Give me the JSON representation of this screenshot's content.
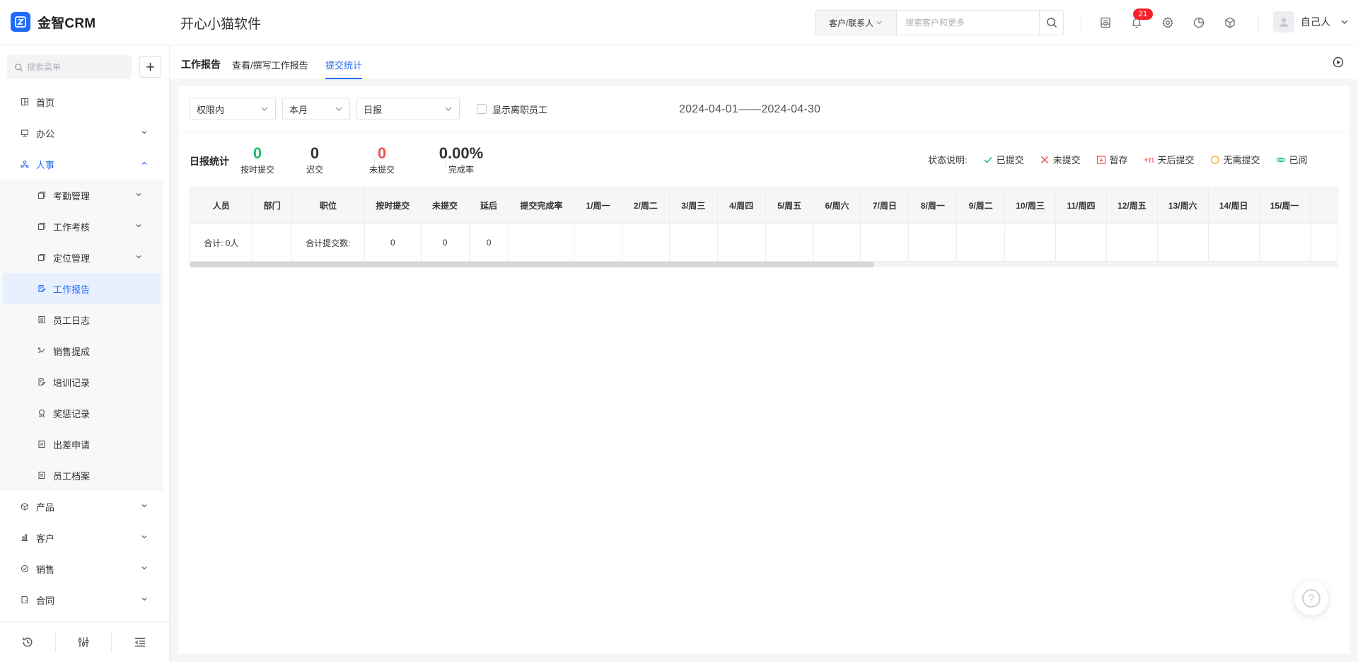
{
  "header": {
    "logo_text": "金智CRM",
    "company_name": "开心小猫软件",
    "search_type": "客户/联系人",
    "search_placeholder": "搜索客户和更多",
    "notification_count": "21",
    "user_name": "自己人",
    "accent_color": "#1f6bff"
  },
  "sidebar": {
    "search_placeholder": "搜索菜单",
    "add_label": "+",
    "items": [
      {
        "label": "首页",
        "icon": "home-icon"
      },
      {
        "label": "办公",
        "icon": "office-icon"
      },
      {
        "label": "人事",
        "icon": "hr-icon"
      },
      {
        "label": "产品",
        "icon": "product-icon"
      },
      {
        "label": "客户",
        "icon": "customer-icon"
      },
      {
        "label": "销售",
        "icon": "sales-icon"
      },
      {
        "label": "合同",
        "icon": "contract-icon"
      }
    ],
    "hr_children": [
      {
        "label": "考勤管理",
        "icon": "attendance-icon"
      },
      {
        "label": "工作考核",
        "icon": "assessment-icon"
      },
      {
        "label": "定位管理",
        "icon": "location-icon"
      },
      {
        "label": "工作报告",
        "icon": "report-icon"
      },
      {
        "label": "员工日志",
        "icon": "log-icon"
      },
      {
        "label": "销售提成",
        "icon": "commission-icon"
      },
      {
        "label": "培训记录",
        "icon": "training-icon"
      },
      {
        "label": "奖惩记录",
        "icon": "reward-icon"
      },
      {
        "label": "出差申请",
        "icon": "trip-icon"
      },
      {
        "label": "员工档案",
        "icon": "archive-icon"
      }
    ]
  },
  "tabs": {
    "title": "工作报告",
    "items": [
      "查看/撰写工作报告",
      "提交统计"
    ],
    "active": "提交统计"
  },
  "filters": {
    "scope": "权限内",
    "period": "本月",
    "report_type": "日报",
    "show_resigned_label": "显示离职员工",
    "date_range": "2024-04-01——2024-04-30"
  },
  "stats": {
    "title": "日报统计",
    "on_time": {
      "value": "0",
      "label": "按时提交",
      "color": "#19be6b"
    },
    "late": {
      "value": "0",
      "label": "迟交",
      "color": "#333333"
    },
    "not_submitted": {
      "value": "0",
      "label": "未提交",
      "color": "#f0504f"
    },
    "completion": {
      "value": "0.00%",
      "label": "完成率",
      "color": "#333333"
    }
  },
  "legend": {
    "title": "状态说明:",
    "items": [
      {
        "symbol": "",
        "label": "已提交",
        "color": "#19be6b",
        "icon": "check-icon"
      },
      {
        "symbol": "",
        "label": "未提交",
        "color": "#f0504f",
        "icon": "cross-icon"
      },
      {
        "symbol": "",
        "label": "暂存",
        "color": "#f0504f",
        "icon": "draft-icon"
      },
      {
        "symbol": "+n",
        "label": "天后提交",
        "color": "#f0504f",
        "icon": ""
      },
      {
        "symbol": "",
        "label": "无需提交",
        "color": "#f5a623",
        "icon": "circle-icon"
      },
      {
        "symbol": "",
        "label": "已阅",
        "color": "#19be6b",
        "icon": "eye-icon"
      }
    ]
  },
  "table": {
    "columns": [
      "人员",
      "部门",
      "职位",
      "按时提交",
      "未提交",
      "延后",
      "提交完成率",
      "1/周一",
      "2/周二",
      "3/周三",
      "4/周四",
      "5/周五",
      "6/周六",
      "7/周日",
      "8/周一",
      "9/周二",
      "10/周三",
      "11/周四",
      "12/周五",
      "13/周六",
      "14/周日",
      "15/周一",
      ""
    ],
    "summary_row": [
      "合计: 0人",
      "",
      "合计提交数:",
      "0",
      "0",
      "0",
      "",
      "",
      "",
      "",
      "",
      "",
      "",
      "",
      "",
      "",
      "",
      "",
      "",
      "",
      "",
      "",
      ""
    ]
  },
  "help_label": "?"
}
